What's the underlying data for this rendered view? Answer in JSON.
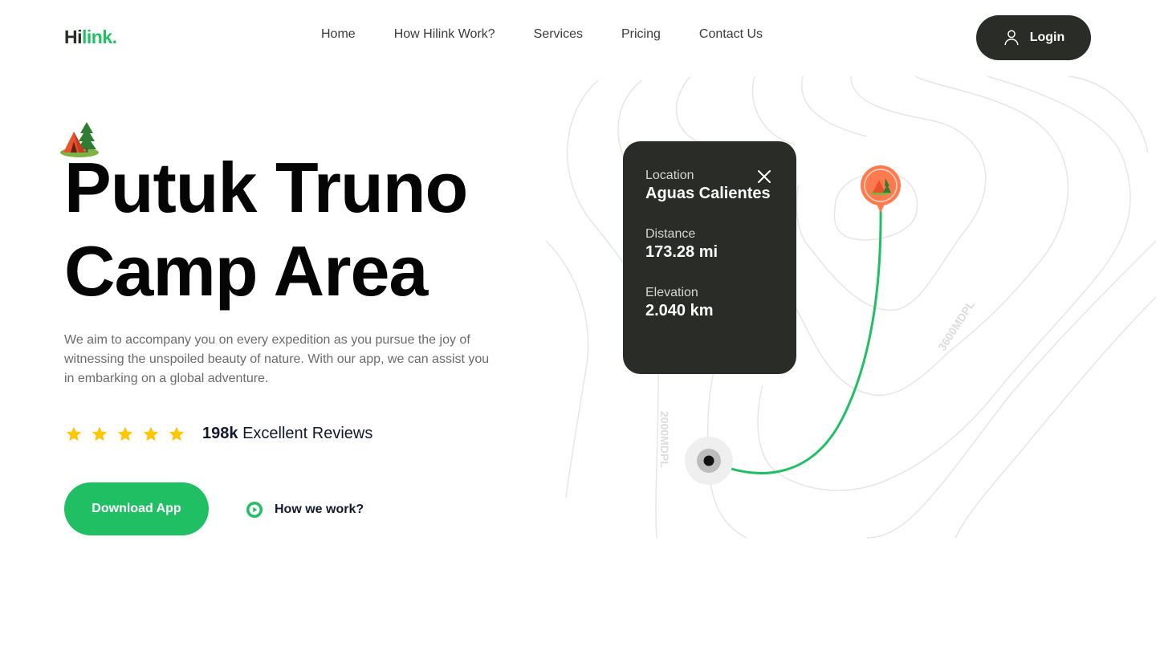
{
  "brand": {
    "part1": "Hi",
    "part2": "link."
  },
  "nav": {
    "items": [
      "Home",
      "How Hilink Work?",
      "Services",
      "Pricing",
      "Contact Us"
    ]
  },
  "login": {
    "label": "Login",
    "icon": "user-icon"
  },
  "hero": {
    "line1": "Putuk Truno",
    "line2": "Camp Area",
    "description": "We aim to accompany you on every expedition as you pursue the joy of witnessing the unspoiled beauty of nature. With our app, we can assist you in embarking on a global adventure.",
    "rating_stars": 5,
    "reviews_count": "198k",
    "reviews_label": "Excellent Reviews",
    "download_label": "Download App",
    "how_label": "How we work?"
  },
  "card": {
    "location_label": "Location",
    "location_value": "Aguas Calientes",
    "distance_label": "Distance",
    "distance_value": "173.28 mi",
    "elevation_label": "Elevation",
    "elevation_value": "2.040 km"
  },
  "map": {
    "contour_label_1": "3600MDPL",
    "contour_label_2": "2000MDPL",
    "route_color": "#20bf63",
    "pin_color": "#ff7b4f"
  },
  "colors": {
    "accent": "#20bf63",
    "dark": "#292c27",
    "star": "#fec601"
  }
}
